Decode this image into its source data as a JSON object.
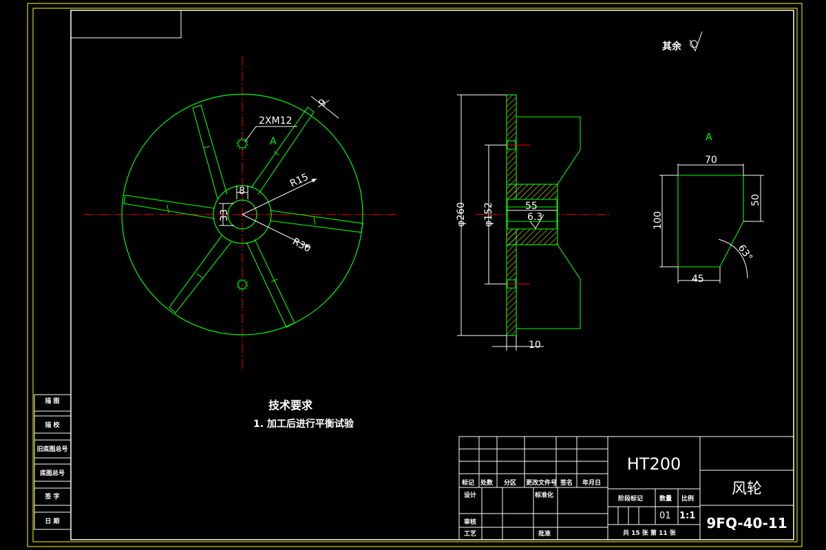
{
  "drawing": {
    "surface_note": "其余",
    "tech_requirements": {
      "title": "技术要求",
      "items": [
        "1. 加工后进行平衡试验"
      ]
    },
    "front_view": {
      "hole_label": "2XM12",
      "view_marker": "A",
      "dims": {
        "rib_width": "9",
        "bore_r": "R15",
        "hub_r": "R30",
        "hub_w": "8",
        "hub_h": "33"
      }
    },
    "section_view": {
      "dims": {
        "outer_dia": "φ260",
        "pcd": "φ152",
        "hub_len": "55",
        "roughness": "6.3",
        "flange_thk": "10"
      }
    },
    "detail_a": {
      "title": "A",
      "dims": {
        "top": "70",
        "height": "100",
        "right": "50",
        "bottom": "45",
        "angle": "63°"
      }
    },
    "left_margin": [
      "描 图",
      "描 校",
      "旧底图总号",
      "底图总号",
      "签 字",
      "日 期"
    ],
    "title_block": {
      "material": "HT200",
      "part_name": "风轮",
      "drawing_no": "9FQ-40-11",
      "quantity_label": "数量",
      "quantity": "01",
      "scale_label": "比例",
      "scale": "1:1",
      "stage_label": "阶段标记",
      "sheets": "共 15 张  第 11 张",
      "headers": [
        "标记",
        "处数",
        "分区",
        "更改文件号",
        "签名",
        "年月日"
      ],
      "design": "设计",
      "standardize": "标准化",
      "check": "审核",
      "process": "工艺",
      "approve": "批准"
    },
    "colors": {
      "frame": "#ffff00",
      "geometry": "#00ff00",
      "center_line": "#ff0000",
      "text": "#ffffff",
      "background": "#000000"
    }
  }
}
